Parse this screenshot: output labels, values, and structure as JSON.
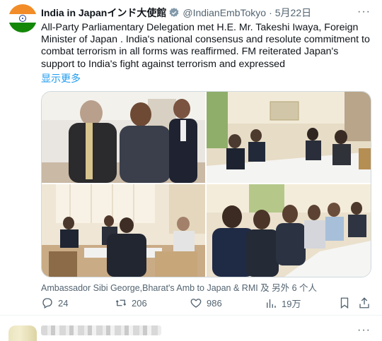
{
  "tweet": {
    "author_name": "India in Japanインド大使館",
    "handle": "@IndianEmbTokyo",
    "separator": "·",
    "date": "5月22日",
    "more_label": "···",
    "text": "All-Party Parliamentary Delegation met  H.E. Mr. Takeshi Iwaya, Foreign Minister of Japan . India's national consensus and resolute commitment to combat terrorism in all forms was reaffirmed. FM reiterated Japan's support to India's fight against terrorism and expressed",
    "show_more": "显示更多",
    "caption": "Ambassador Sibi George,Bharat's Amb to Japan & RMI 及 另外 6 个人",
    "actions": {
      "replies": "24",
      "reposts": "206",
      "likes": "986",
      "views": "19万"
    },
    "icons": [
      "verified-badge-icon",
      "reply-icon",
      "repost-icon",
      "like-icon",
      "views-icon",
      "bookmark-icon",
      "share-icon"
    ]
  },
  "next_tweet": {
    "more_label": "···"
  },
  "colors": {
    "text": "#0f1419",
    "secondary": "#536471",
    "link": "#1d9bf0",
    "border": "#cfd9de"
  }
}
